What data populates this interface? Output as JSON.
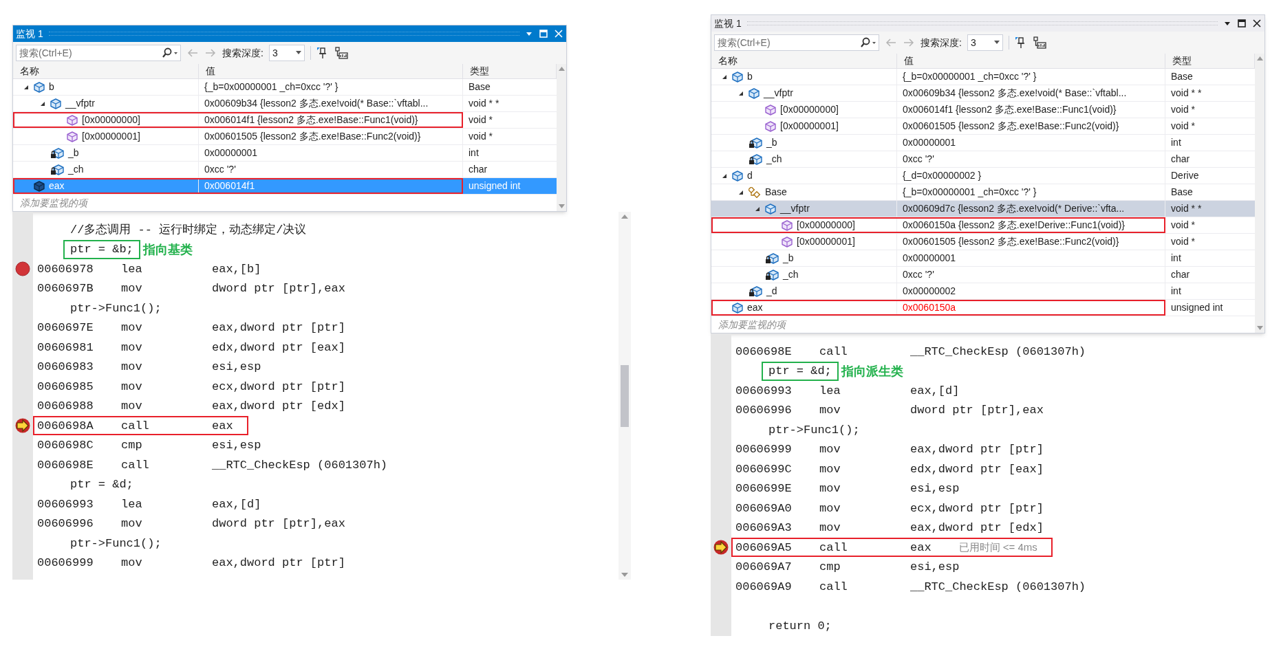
{
  "panels": [
    {
      "watch": {
        "title": "监视 1",
        "active": true,
        "search": {
          "placeholder": "搜索(Ctrl+E)"
        },
        "depth_label": "搜索深度:",
        "depth_value": "3",
        "columns": [
          "名称",
          "值",
          "类型"
        ],
        "rows": [
          {
            "name": "b",
            "kind": "object",
            "expanded": true,
            "selected": false,
            "outlined": false,
            "changed": false,
            "value": "{_b=0x00000001 _ch=0xcc '?' }",
            "type": "Base",
            "children": [
              {
                "name": "__vfptr",
                "kind": "object",
                "expanded": true,
                "selected": false,
                "outlined": false,
                "changed": false,
                "value": "0x00609b34 {lesson2 多态.exe!void(* Base::`vftabl...",
                "type": "void * *",
                "children": [
                  {
                    "name": "[0x00000000]",
                    "kind": "entry",
                    "selected": false,
                    "outlined": true,
                    "changed": false,
                    "value": "0x006014f1 {lesson2 多态.exe!Base::Func1(void)}",
                    "type": "void *"
                  },
                  {
                    "name": "[0x00000001]",
                    "kind": "entry",
                    "selected": false,
                    "outlined": false,
                    "changed": false,
                    "value": "0x00601505 {lesson2 多态.exe!Base::Func2(void)}",
                    "type": "void *"
                  }
                ]
              },
              {
                "name": "_b",
                "kind": "private",
                "selected": false,
                "outlined": false,
                "changed": false,
                "value": "0x00000001",
                "type": "int"
              },
              {
                "name": "_ch",
                "kind": "private",
                "selected": false,
                "outlined": false,
                "changed": false,
                "value": "0xcc '?'",
                "type": "char"
              }
            ]
          },
          {
            "name": "eax",
            "kind": "object",
            "selected": true,
            "outlined": true,
            "changed": false,
            "value": "0x006014f1",
            "type": "unsigned int"
          }
        ],
        "add_hint": "添加要监视的项"
      },
      "disasm": [
        {
          "kind": "source",
          "text": "//多态调用 -- 运行时绑定，动态绑定/决议",
          "framed": false
        },
        {
          "kind": "source",
          "text": "ptr = &b;",
          "framed": true,
          "color": "#22b14c",
          "callout": "指向基类"
        },
        {
          "kind": "asm",
          "address": "00606978",
          "op": "lea",
          "operand": "eax,[b]",
          "breakpoint": true,
          "current": false,
          "framed": false
        },
        {
          "kind": "asm",
          "address": "0060697B",
          "op": "mov",
          "operand": "dword ptr [ptr],eax",
          "breakpoint": false,
          "current": false,
          "framed": false
        },
        {
          "kind": "source",
          "text": "ptr->Func1();",
          "framed": false
        },
        {
          "kind": "asm",
          "address": "0060697E",
          "op": "mov",
          "operand": "eax,dword ptr [ptr]",
          "breakpoint": false,
          "current": false,
          "framed": false
        },
        {
          "kind": "asm",
          "address": "00606981",
          "op": "mov",
          "operand": "edx,dword ptr [eax]",
          "breakpoint": false,
          "current": false,
          "framed": false
        },
        {
          "kind": "asm",
          "address": "00606983",
          "op": "mov",
          "operand": "esi,esp",
          "breakpoint": false,
          "current": false,
          "framed": false
        },
        {
          "kind": "asm",
          "address": "00606985",
          "op": "mov",
          "operand": "ecx,dword ptr [ptr]",
          "breakpoint": false,
          "current": false,
          "framed": false
        },
        {
          "kind": "asm",
          "address": "00606988",
          "op": "mov",
          "operand": "eax,dword ptr [edx]",
          "breakpoint": false,
          "current": false,
          "framed": false
        },
        {
          "kind": "asm",
          "address": "0060698A",
          "op": "call",
          "operand": "eax",
          "breakpoint": false,
          "current": true,
          "framed": true,
          "color": "#e8202a"
        },
        {
          "kind": "asm",
          "address": "0060698C",
          "op": "cmp",
          "operand": "esi,esp",
          "breakpoint": false,
          "current": false,
          "framed": false
        },
        {
          "kind": "asm",
          "address": "0060698E",
          "op": "call",
          "operand": "__RTC_CheckEsp (0601307h)",
          "breakpoint": false,
          "current": false,
          "framed": false
        },
        {
          "kind": "source",
          "text": "ptr = &d;",
          "framed": false
        },
        {
          "kind": "asm",
          "address": "00606993",
          "op": "lea",
          "operand": "eax,[d]",
          "breakpoint": false,
          "current": false,
          "framed": false
        },
        {
          "kind": "asm",
          "address": "00606996",
          "op": "mov",
          "operand": "dword ptr [ptr],eax",
          "breakpoint": false,
          "current": false,
          "framed": false
        },
        {
          "kind": "source",
          "text": "ptr->Func1();",
          "framed": false
        },
        {
          "kind": "asm",
          "address": "00606999",
          "op": "mov",
          "operand": "eax,dword ptr [ptr]",
          "breakpoint": false,
          "current": false,
          "framed": false
        }
      ]
    },
    {
      "watch": {
        "title": "监视 1",
        "active": false,
        "search": {
          "placeholder": "搜索(Ctrl+E)"
        },
        "depth_label": "搜索深度:",
        "depth_value": "3",
        "columns": [
          "名称",
          "值",
          "类型"
        ],
        "rows": [
          {
            "name": "b",
            "kind": "object",
            "expanded": true,
            "selected": false,
            "outlined": false,
            "changed": false,
            "value": "{_b=0x00000001 _ch=0xcc '?' }",
            "type": "Base",
            "children": [
              {
                "name": "__vfptr",
                "kind": "object",
                "expanded": true,
                "selected": false,
                "outlined": false,
                "changed": false,
                "value": "0x00609b34 {lesson2 多态.exe!void(* Base::`vftabl...",
                "type": "void * *",
                "children": [
                  {
                    "name": "[0x00000000]",
                    "kind": "entry",
                    "selected": false,
                    "outlined": false,
                    "changed": false,
                    "value": "0x006014f1 {lesson2 多态.exe!Base::Func1(void)}",
                    "type": "void *"
                  },
                  {
                    "name": "[0x00000001]",
                    "kind": "entry",
                    "selected": false,
                    "outlined": false,
                    "changed": false,
                    "value": "0x00601505 {lesson2 多态.exe!Base::Func2(void)}",
                    "type": "void *"
                  }
                ]
              },
              {
                "name": "_b",
                "kind": "private",
                "selected": false,
                "outlined": false,
                "changed": false,
                "value": "0x00000001",
                "type": "int"
              },
              {
                "name": "_ch",
                "kind": "private",
                "selected": false,
                "outlined": false,
                "changed": false,
                "value": "0xcc '?'",
                "type": "char"
              }
            ]
          },
          {
            "name": "d",
            "kind": "object",
            "expanded": true,
            "selected": false,
            "outlined": false,
            "changed": false,
            "value": "{_d=0x00000002 }",
            "type": "Derive",
            "children": [
              {
                "name": "Base",
                "kind": "base",
                "expanded": true,
                "selected": false,
                "outlined": false,
                "changed": false,
                "value": "{_b=0x00000001 _ch=0xcc '?' }",
                "type": "Base",
                "children": [
                  {
                    "name": "__vfptr",
                    "kind": "object",
                    "expanded": true,
                    "selected": true,
                    "outlined": false,
                    "changed": false,
                    "value": "0x00609d7c {lesson2 多态.exe!void(* Derive::`vfta...",
                    "type": "void * *",
                    "children": [
                      {
                        "name": "[0x00000000]",
                        "kind": "entry",
                        "selected": false,
                        "outlined": true,
                        "changed": false,
                        "value": "0x0060150a {lesson2 多态.exe!Derive::Func1(void)}",
                        "type": "void *"
                      },
                      {
                        "name": "[0x00000001]",
                        "kind": "entry",
                        "selected": false,
                        "outlined": false,
                        "changed": false,
                        "value": "0x00601505 {lesson2 多态.exe!Base::Func2(void)}",
                        "type": "void *"
                      }
                    ]
                  },
                  {
                    "name": "_b",
                    "kind": "private",
                    "selected": false,
                    "outlined": false,
                    "changed": false,
                    "value": "0x00000001",
                    "type": "int"
                  },
                  {
                    "name": "_ch",
                    "kind": "private",
                    "selected": false,
                    "outlined": false,
                    "changed": false,
                    "value": "0xcc '?'",
                    "type": "char"
                  }
                ]
              },
              {
                "name": "_d",
                "kind": "private",
                "selected": false,
                "outlined": false,
                "changed": false,
                "value": "0x00000002",
                "type": "int"
              }
            ]
          },
          {
            "name": "eax",
            "kind": "object",
            "selected": false,
            "outlined": true,
            "changed": true,
            "value": "0x0060150a",
            "type": "unsigned int"
          }
        ],
        "add_hint": "添加要监视的项"
      },
      "disasm": [
        {
          "kind": "asm",
          "address": "0060698E",
          "op": "call",
          "operand": "__RTC_CheckEsp (0601307h)",
          "breakpoint": false,
          "current": false,
          "framed": false
        },
        {
          "kind": "source",
          "text": "ptr = &d;",
          "framed": true,
          "color": "#22b14c",
          "callout": "指向派生类"
        },
        {
          "kind": "asm",
          "address": "00606993",
          "op": "lea",
          "operand": "eax,[d]",
          "breakpoint": false,
          "current": false,
          "framed": false
        },
        {
          "kind": "asm",
          "address": "00606996",
          "op": "mov",
          "operand": "dword ptr [ptr],eax",
          "breakpoint": false,
          "current": false,
          "framed": false
        },
        {
          "kind": "source",
          "text": "ptr->Func1();",
          "framed": false
        },
        {
          "kind": "asm",
          "address": "00606999",
          "op": "mov",
          "operand": "eax,dword ptr [ptr]",
          "breakpoint": false,
          "current": false,
          "framed": false
        },
        {
          "kind": "asm",
          "address": "0060699C",
          "op": "mov",
          "operand": "edx,dword ptr [eax]",
          "breakpoint": false,
          "current": false,
          "framed": false
        },
        {
          "kind": "asm",
          "address": "0060699E",
          "op": "mov",
          "operand": "esi,esp",
          "breakpoint": false,
          "current": false,
          "framed": false
        },
        {
          "kind": "asm",
          "address": "006069A0",
          "op": "mov",
          "operand": "ecx,dword ptr [ptr]",
          "breakpoint": false,
          "current": false,
          "framed": false
        },
        {
          "kind": "asm",
          "address": "006069A3",
          "op": "mov",
          "operand": "eax,dword ptr [edx]",
          "breakpoint": false,
          "current": false,
          "framed": false
        },
        {
          "kind": "asm",
          "address": "006069A5",
          "op": "call",
          "operand": "eax",
          "breakpoint": false,
          "current": true,
          "framed": true,
          "color": "#e8202a",
          "note": "已用时间 <= 4ms"
        },
        {
          "kind": "asm",
          "address": "006069A7",
          "op": "cmp",
          "operand": "esi,esp",
          "breakpoint": false,
          "current": false,
          "framed": false
        },
        {
          "kind": "asm",
          "address": "006069A9",
          "op": "call",
          "operand": "__RTC_CheckEsp (0601307h)",
          "breakpoint": false,
          "current": false,
          "framed": false
        },
        {
          "kind": "blank"
        },
        {
          "kind": "source",
          "text": "return 0;",
          "framed": false
        }
      ]
    }
  ]
}
